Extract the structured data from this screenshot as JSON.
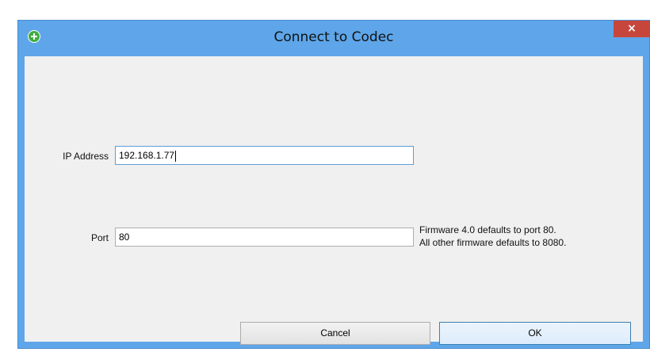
{
  "window": {
    "title": "Connect to Codec",
    "close_glyph": "×",
    "app_icon": "green-plus-circle-icon",
    "accent_color": "#5ea6e9",
    "close_color": "#c7463c"
  },
  "form": {
    "ip_label": "IP Address",
    "ip_value": "192.168.1.77",
    "port_label": "Port",
    "port_value": "80",
    "port_hint_line1": "Firmware 4.0 defaults to port 80.",
    "port_hint_line2": "All other firmware defaults to 8080."
  },
  "buttons": {
    "cancel_label": "Cancel",
    "ok_label": "OK"
  }
}
